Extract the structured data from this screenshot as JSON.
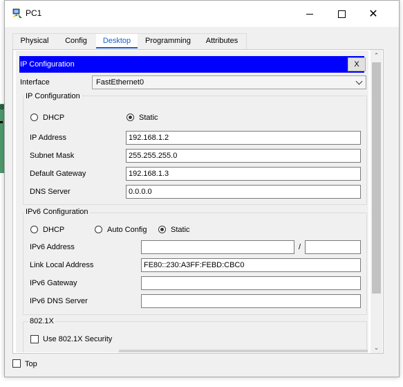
{
  "window": {
    "title": "PC1",
    "minimize_label": "",
    "maximize_label": "",
    "close_label": "✕"
  },
  "background_app": {
    "edge_char": "8"
  },
  "tabs": [
    {
      "label": "Physical"
    },
    {
      "label": "Config"
    },
    {
      "label": "Desktop"
    },
    {
      "label": "Programming"
    },
    {
      "label": "Attributes"
    }
  ],
  "active_tab": "Desktop",
  "panel": {
    "title": "IP Configuration",
    "close_label": "X"
  },
  "interface": {
    "label": "Interface",
    "value": "FastEthernet0"
  },
  "ipv4": {
    "group_title": "IP Configuration",
    "dhcp_label": "DHCP",
    "static_label": "Static",
    "mode": "Static",
    "ip_label": "IP Address",
    "ip_value": "192.168.1.2",
    "mask_label": "Subnet Mask",
    "mask_value": "255.255.255.0",
    "gateway_label": "Default Gateway",
    "gateway_value": "192.168.1.3",
    "dns_label": "DNS Server",
    "dns_value": "0.0.0.0"
  },
  "ipv6": {
    "group_title": "IPv6 Configuration",
    "dhcp_label": "DHCP",
    "auto_label": "Auto Config",
    "static_label": "Static",
    "mode": "Static",
    "address_label": "IPv6 Address",
    "address_value": "",
    "prefix_separator": "/",
    "prefix_value": "",
    "link_local_label": "Link Local Address",
    "link_local_value": "FE80::230:A3FF:FEBD:CBC0",
    "gateway_label": "IPv6 Gateway",
    "gateway_value": "",
    "dns_label": "IPv6 DNS Server",
    "dns_value": ""
  },
  "dot1x": {
    "group_title": "802.1X",
    "checkbox_label": "Use 802.1X Security",
    "checked": false
  },
  "footer": {
    "top_label": "Top",
    "top_checked": false
  },
  "colors": {
    "header_bar": "#0000ff",
    "active_tab": "#1c5fc4"
  }
}
